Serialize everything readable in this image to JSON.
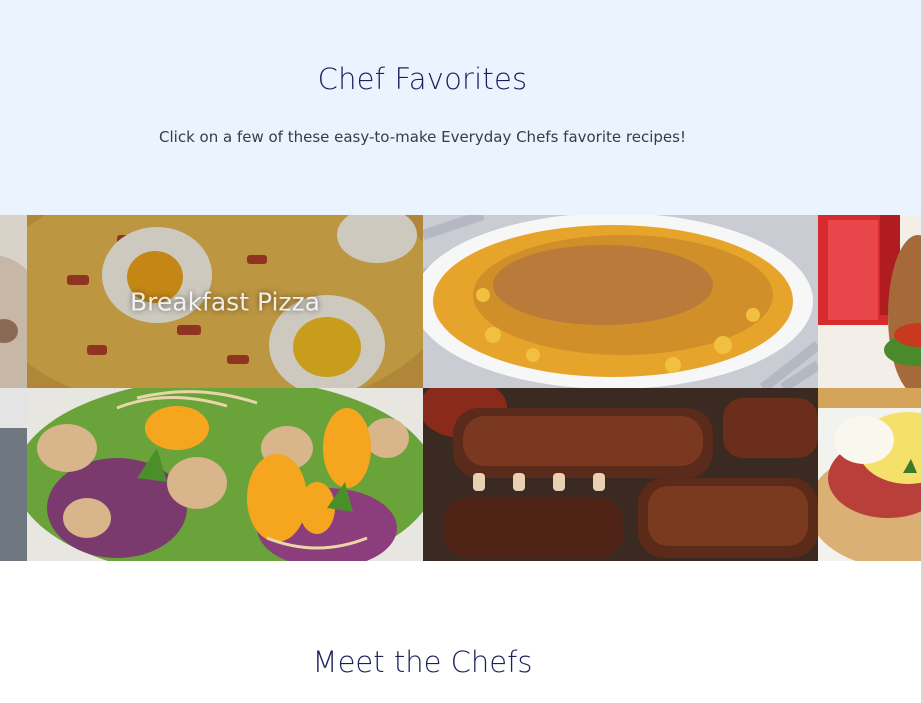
{
  "hero": {
    "title": "Chef Favorites",
    "subtitle": "Click on a few of these easy-to-make Everyday Chefs favorite recipes!"
  },
  "recipes": [
    {
      "id": "partial-left-top",
      "label": ""
    },
    {
      "id": "breakfast-pizza",
      "label": "Breakfast Pizza"
    },
    {
      "id": "mac-and-cheese",
      "label": ""
    },
    {
      "id": "burger-drink",
      "label": ""
    },
    {
      "id": "partial-left-bottom",
      "label": ""
    },
    {
      "id": "asian-salad",
      "label": ""
    },
    {
      "id": "bbq-ribs",
      "label": ""
    },
    {
      "id": "eggs-benedict",
      "label": ""
    }
  ],
  "meet": {
    "title": "Meet the Chefs"
  },
  "colors": {
    "hero_bg": "#ebf3fe",
    "heading": "#1c1f5c",
    "body_text": "#3a3a4a"
  }
}
